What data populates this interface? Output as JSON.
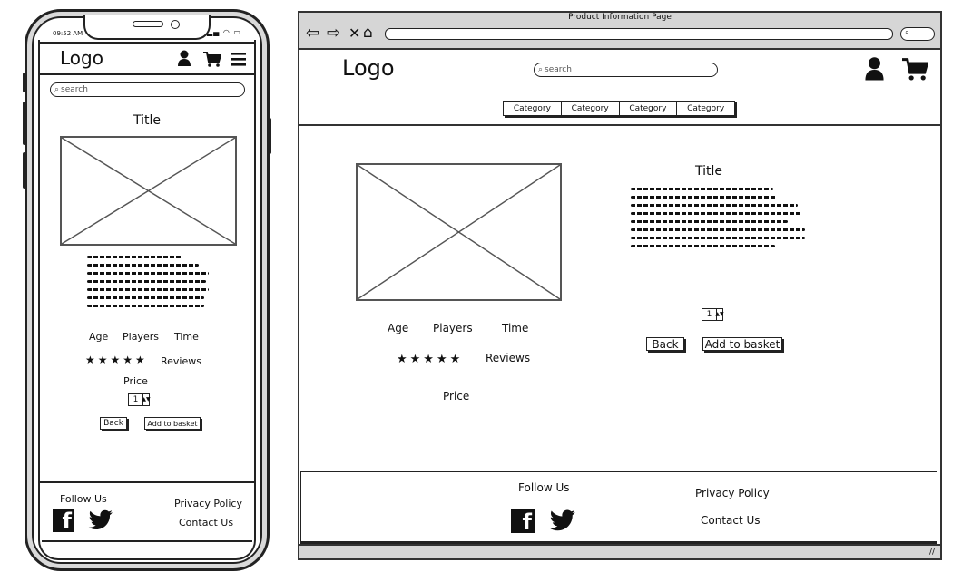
{
  "mobile": {
    "status_time": "09:52 AM",
    "logo": "Logo",
    "search_placeholder": "search",
    "title": "Title",
    "specs": [
      "Age",
      "Players",
      "Time"
    ],
    "stars": "★★★★★",
    "reviews_label": "Reviews",
    "price_label": "Price",
    "quantity": "1",
    "back_label": "Back",
    "add_label": "Add to basket",
    "footer": {
      "follow_label": "Follow Us",
      "privacy_label": "Privacy Policy",
      "contact_label": "Contact Us"
    }
  },
  "desktop": {
    "window_title": "Product Information Page",
    "logo": "Logo",
    "search_placeholder": "search",
    "categories": [
      "Category",
      "Category",
      "Category",
      "Category"
    ],
    "title": "Title",
    "specs": [
      "Age",
      "Players",
      "Time"
    ],
    "stars": "★★★★★",
    "reviews_label": "Reviews",
    "price_label": "Price",
    "quantity": "1",
    "back_label": "Back",
    "add_label": "Add to basket",
    "footer": {
      "follow_label": "Follow Us",
      "privacy_label": "Privacy Policy",
      "contact_label": "Contact Us"
    }
  },
  "icons": {
    "user": "user-icon",
    "cart": "cart-icon",
    "menu": "hamburger-menu-icon",
    "facebook": "facebook-icon",
    "twitter": "twitter-icon",
    "back": "back-arrow-icon",
    "forward": "forward-arrow-icon",
    "close": "close-icon",
    "home": "home-icon"
  },
  "colors": {
    "chrome_gray": "#d6d6d6",
    "ink": "#111111"
  }
}
